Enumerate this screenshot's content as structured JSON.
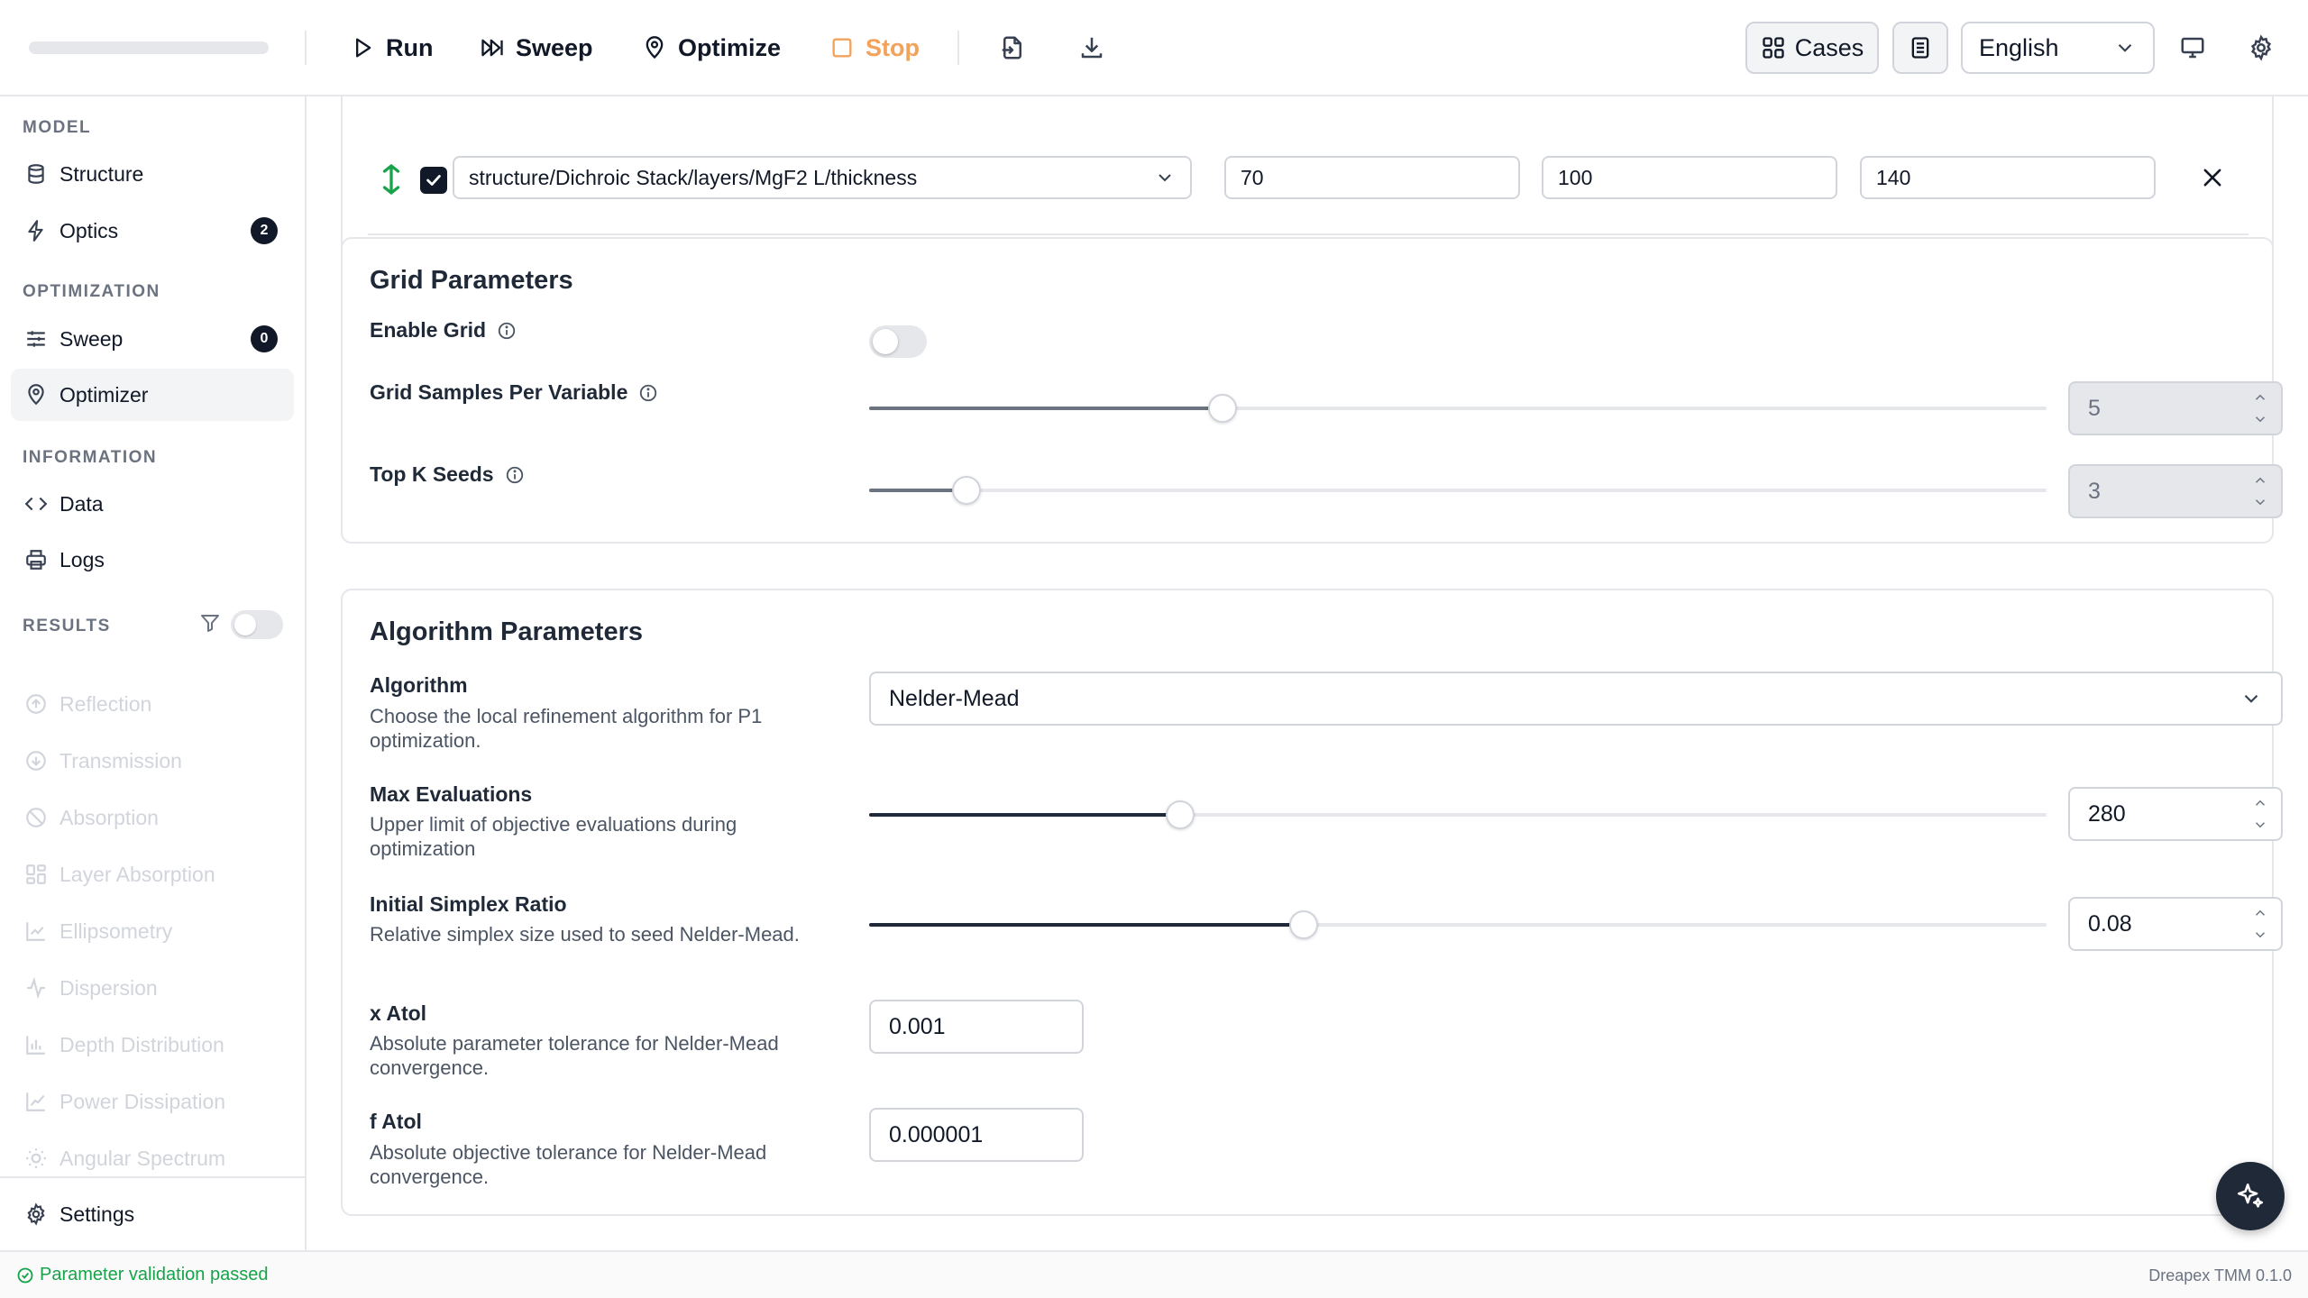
{
  "toolbar": {
    "run": "Run",
    "sweep": "Sweep",
    "optimize": "Optimize",
    "stop": "Stop",
    "cases": "Cases",
    "language": "English"
  },
  "sidebar": {
    "model_title": "MODEL",
    "optimization_title": "OPTIMIZATION",
    "information_title": "INFORMATION",
    "results_title": "RESULTS",
    "items": {
      "structure": "Structure",
      "optics": "Optics",
      "optics_badge": "2",
      "sweep": "Sweep",
      "sweep_badge": "0",
      "optimizer": "Optimizer",
      "data": "Data",
      "logs": "Logs",
      "reflection": "Reflection",
      "transmission": "Transmission",
      "absorption": "Absorption",
      "layer_absorption": "Layer Absorption",
      "ellipsometry": "Ellipsometry",
      "dispersion": "Dispersion",
      "depth_distribution": "Depth Distribution",
      "power_dissipation": "Power Dissipation",
      "angular_spectrum": "Angular Spectrum",
      "settings": "Settings"
    }
  },
  "variable_row": {
    "path": "structure/Dichroic Stack/layers/MgF2 L/thickness",
    "min": "70",
    "initial": "100",
    "max": "140"
  },
  "grid": {
    "title": "Grid Parameters",
    "enable_label": "Enable Grid",
    "enabled": false,
    "samples_label": "Grid Samples Per Variable",
    "samples_value": "5",
    "samples_fraction": 0.3,
    "topk_label": "Top K Seeds",
    "topk_value": "3",
    "topk_fraction": 0.083
  },
  "algorithm": {
    "title": "Algorithm Parameters",
    "algorithm_label": "Algorithm",
    "algorithm_desc": "Choose the local refinement algorithm for P1 optimization.",
    "algorithm_value": "Nelder-Mead",
    "max_eval_label": "Max Evaluations",
    "max_eval_desc": "Upper limit of objective evaluations during optimization",
    "max_eval_value": "280",
    "max_eval_fraction": 0.264,
    "simplex_label": "Initial Simplex Ratio",
    "simplex_desc": "Relative simplex size used to seed Nelder-Mead.",
    "simplex_value": "0.08",
    "simplex_fraction": 0.369,
    "xatol_label": "x Atol",
    "xatol_desc": "Absolute parameter tolerance for Nelder-Mead convergence.",
    "xatol_value": "0.001",
    "fatol_label": "f Atol",
    "fatol_desc": "Absolute objective tolerance for Nelder-Mead convergence.",
    "fatol_value": "0.000001"
  },
  "status": {
    "message": "Parameter validation passed",
    "version": "Dreapex TMM 0.1.0"
  },
  "colors": {
    "accent": "#1f2937",
    "stop": "#f2a25a",
    "success": "#16a34a",
    "move_icon": "#16a34a"
  }
}
